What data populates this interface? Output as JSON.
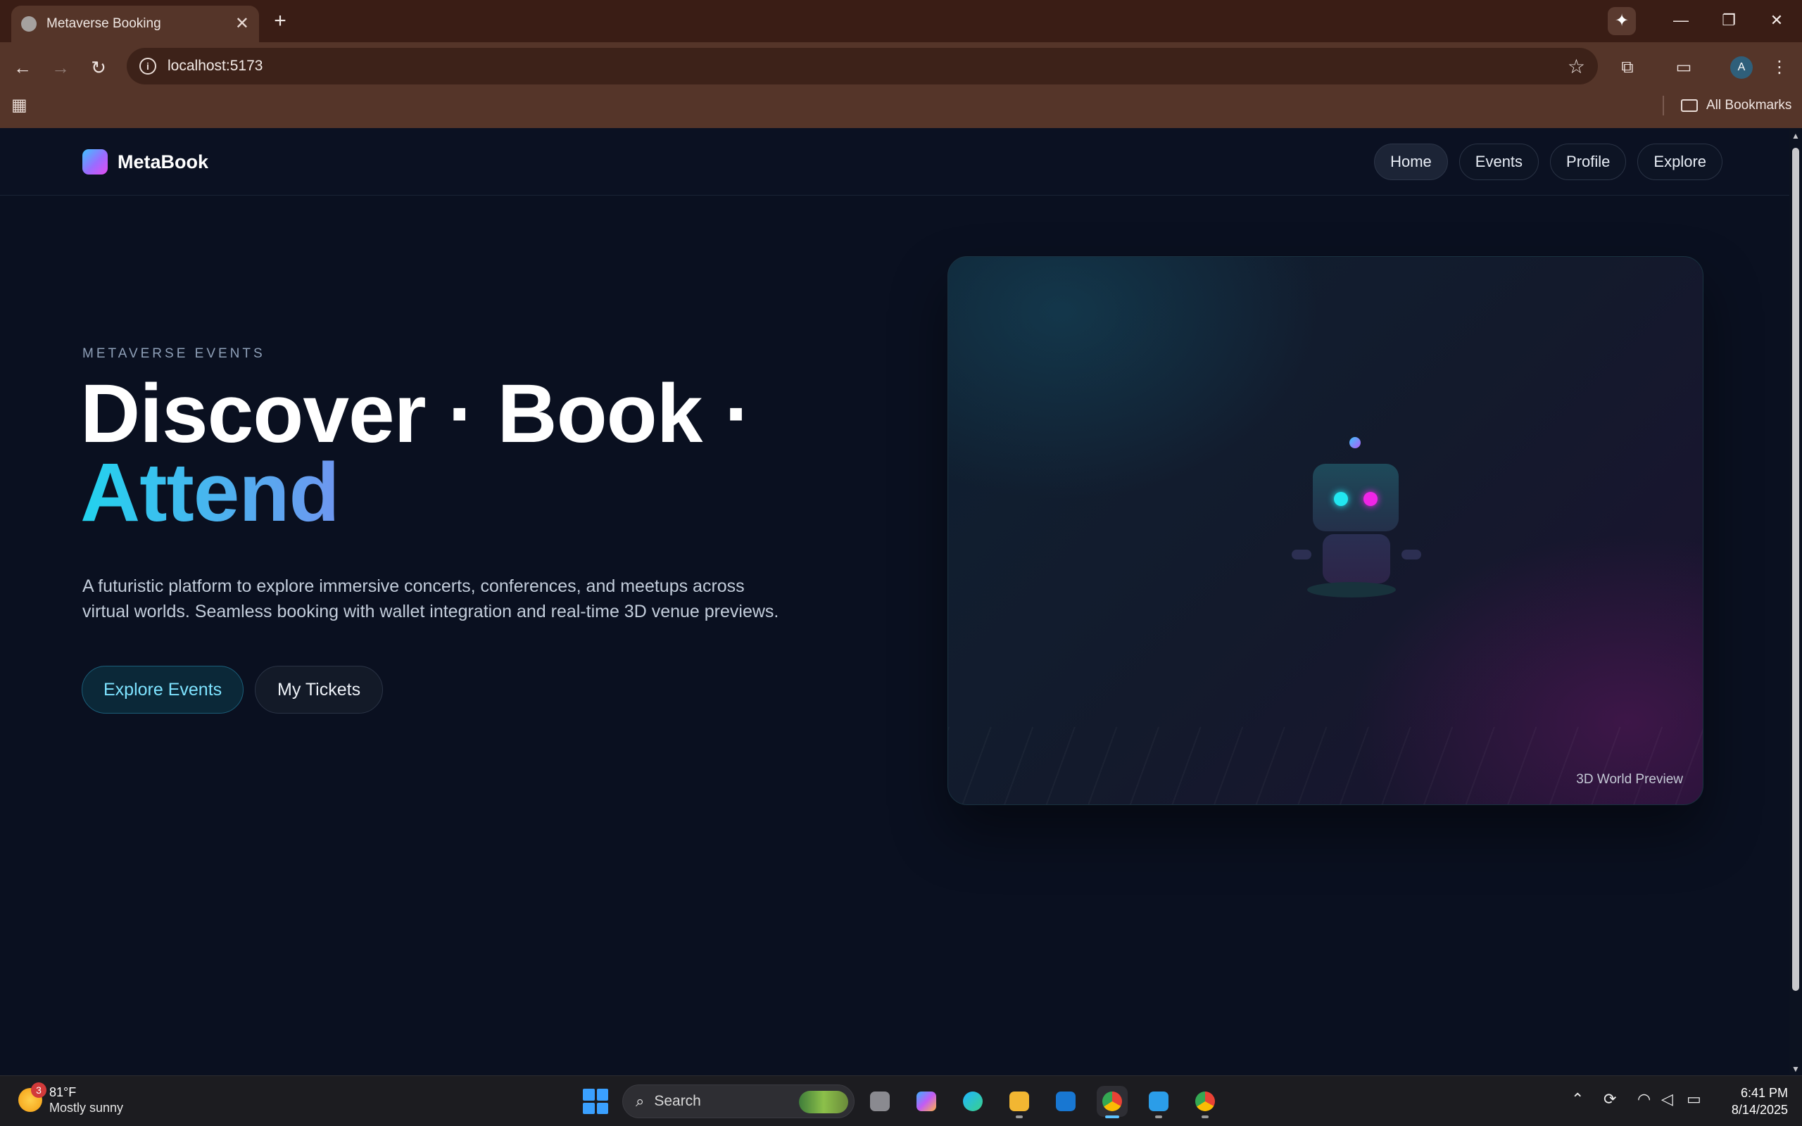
{
  "browser": {
    "tab_title": "Metaverse Booking",
    "tab_close": "✕",
    "new_tab": "+",
    "url": "localhost:5173",
    "bookmarks_label": "All Bookmarks"
  },
  "site": {
    "brand": "MetaBook",
    "nav": [
      "Home",
      "Events",
      "Profile",
      "Explore"
    ],
    "active_nav": "Home"
  },
  "hero": {
    "eyebrow": "METAVERSE EVENTS",
    "headline_line1": "Discover · Book ·",
    "headline_line2": "Attend",
    "description": "A futuristic platform to explore immersive concerts, conferences, and meetups across virtual worlds. Seamless booking with wallet integration and real-time 3D venue previews.",
    "primary_cta": "Explore Events",
    "secondary_cta": "My Tickets"
  },
  "preview": {
    "caption": "3D World Preview"
  },
  "taskbar": {
    "weather_temp": "81°F",
    "weather_desc": "Mostly sunny",
    "weather_badge": "3",
    "search_label": "Search",
    "time": "6:41 PM",
    "date": "8/14/2025"
  },
  "colors": {
    "page_bg": "#0a1020",
    "accent_cyan": "#22d3ee",
    "accent_magenta": "#d946ef",
    "tab_strip": "#3a1d15",
    "toolbar": "#553529"
  },
  "icons": {
    "back": "arrow-left-icon",
    "forward": "arrow-right-icon",
    "reload": "reload-icon",
    "info": "site-info-icon",
    "bookmark": "star-icon",
    "extensions": "puzzle-icon",
    "apps": "apps-grid-icon"
  }
}
